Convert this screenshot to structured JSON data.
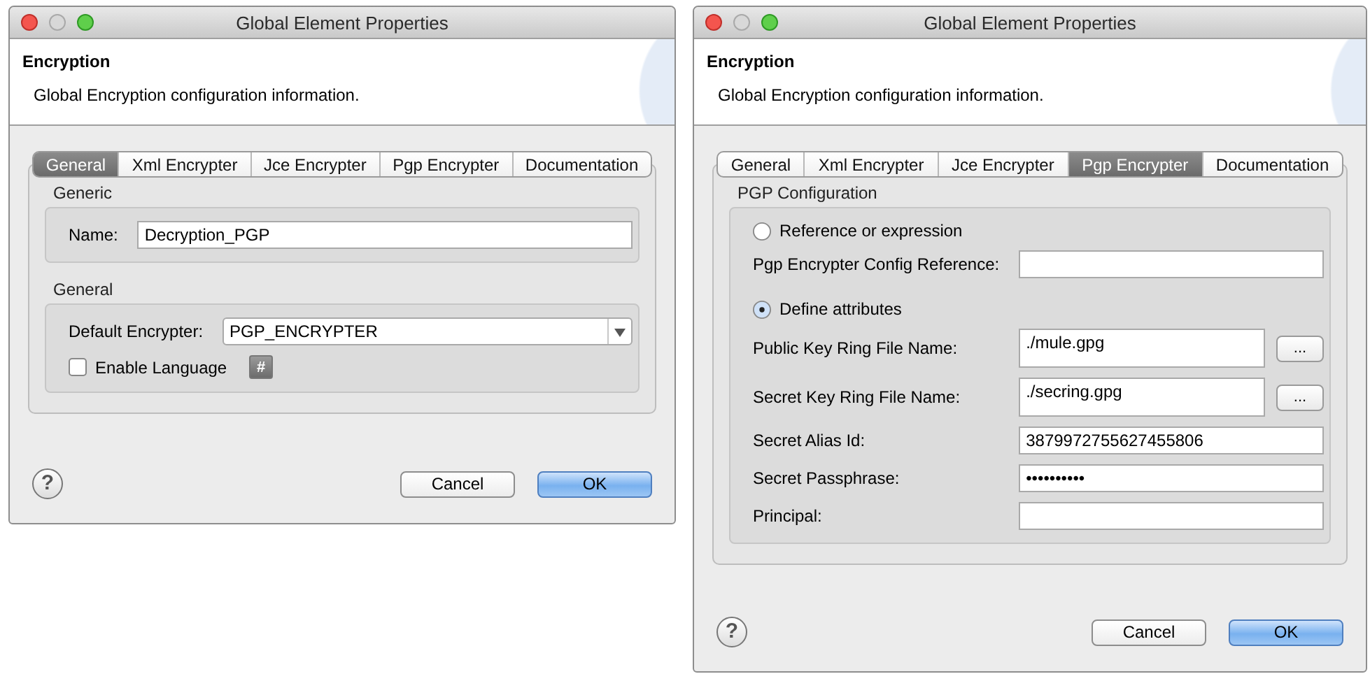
{
  "windows": [
    {
      "title": "Global Element Properties",
      "header": {
        "title": "Encryption",
        "description": "Global Encryption configuration information."
      },
      "tabs": [
        {
          "label": "General",
          "selected": true
        },
        {
          "label": "Xml Encrypter",
          "selected": false
        },
        {
          "label": "Jce Encrypter",
          "selected": false
        },
        {
          "label": "Pgp Encrypter",
          "selected": false
        },
        {
          "label": "Documentation",
          "selected": false
        }
      ],
      "groups": [
        {
          "title": "Generic",
          "rows": [
            {
              "kind": "text",
              "label": "Name:",
              "value": "Decryption_PGP"
            }
          ]
        },
        {
          "title": "General",
          "rows": [
            {
              "kind": "select",
              "label": "Default Encrypter:",
              "value": "PGP_ENCRYPTER"
            },
            {
              "kind": "checkbox",
              "label": "Enable Language",
              "checked": false,
              "button": "#"
            }
          ]
        }
      ],
      "help": "?",
      "buttons": [
        {
          "label": "Cancel",
          "default": false
        },
        {
          "label": "OK",
          "default": true
        }
      ]
    },
    {
      "title": "Global Element Properties",
      "header": {
        "title": "Encryption",
        "description": "Global Encryption configuration information."
      },
      "tabs": [
        {
          "label": "General",
          "selected": false
        },
        {
          "label": "Xml Encrypter",
          "selected": false
        },
        {
          "label": "Jce Encrypter",
          "selected": false
        },
        {
          "label": "Pgp Encrypter",
          "selected": true
        },
        {
          "label": "Documentation",
          "selected": false
        }
      ],
      "groups": [
        {
          "title": "PGP Configuration",
          "rows": [
            {
              "kind": "radio",
              "label": "Reference or expression",
              "selected": false
            },
            {
              "kind": "text",
              "label": "Pgp Encrypter Config Reference:"
            },
            {
              "kind": "radio",
              "label": "Define attributes",
              "selected": true
            },
            {
              "kind": "file",
              "label": "Public Key Ring File Name:",
              "value": "./mule.gpg",
              "button": "..."
            },
            {
              "kind": "file",
              "label": "Secret Key Ring File Name:",
              "value": "./secring.gpg",
              "button": "..."
            },
            {
              "kind": "text",
              "label": "Secret Alias Id:",
              "value": "3879972755627455806"
            },
            {
              "kind": "text",
              "label": "Secret Passphrase:",
              "value": "••••••••••"
            },
            {
              "kind": "text",
              "label": "Principal:"
            }
          ]
        }
      ],
      "help": "?",
      "buttons": [
        {
          "label": "Cancel",
          "default": false
        },
        {
          "label": "OK",
          "default": true
        }
      ]
    }
  ]
}
